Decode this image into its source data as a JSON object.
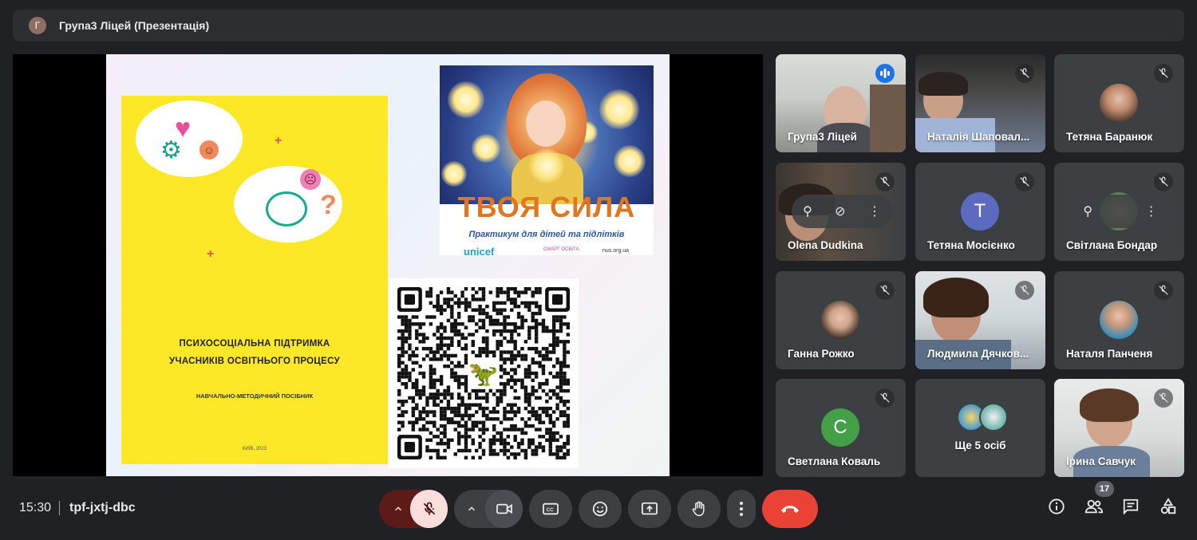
{
  "meeting": {
    "title_initial": "Г",
    "title": "Група3 Ліцей (Презентація)",
    "time": "15:30",
    "code": "tpf-jxtj-dbc",
    "participant_count": "17"
  },
  "slide": {
    "book": {
      "title_line1": "ПСИХОСОЦІАЛЬНА ПІДТРИМКА",
      "title_line2": "УЧАСНИКІВ ОСВІТНЬОГО ПРОЦЕСУ",
      "subtitle": "НАВЧАЛЬНО-МЕТОДИЧНИЙ ПОСІБНИК",
      "city": "КИЇВ, 2023"
    },
    "cover": {
      "title": "ТВОЯ СИЛА",
      "subtitle": "Практикум для дітей та підлітків",
      "logo_unicef": "unicef",
      "logo_smart": "СМАРТ ОСВІТА",
      "logo_nus": "nus.org.ua"
    }
  },
  "participants": [
    {
      "name": "Група3 Ліцей",
      "state": "speaking"
    },
    {
      "name": "Наталія Шаповал...",
      "state": "muted"
    },
    {
      "name": "Тетяна Баранюк",
      "state": "muted"
    },
    {
      "name": "Olena Dudkina",
      "state": "muted"
    },
    {
      "name": "Тетяна Мосієнко",
      "state": "muted",
      "initial": "Т"
    },
    {
      "name": "Світлана Бондар",
      "state": "muted"
    },
    {
      "name": "Ганна Рожко",
      "state": "muted"
    },
    {
      "name": "Людмила Дячков...",
      "state": "muted"
    },
    {
      "name": "Наталя Панченя",
      "state": "muted"
    },
    {
      "name": "Светлана Коваль",
      "state": "muted",
      "initial": "C"
    },
    {
      "name": "Ще 5 осіб",
      "state": "more"
    },
    {
      "name": "Ірина Савчук",
      "state": "muted"
    }
  ],
  "colors": {
    "accent_blue": "#1a73e8",
    "end_call_red": "#ea4335",
    "mic_off_pink": "#f9dedc",
    "avatar_purple": "#5c6bc0",
    "avatar_green": "#43a047"
  },
  "controls": {
    "icons": [
      "chevron-up-icon",
      "mic-off-icon",
      "chevron-up-icon",
      "camera-icon",
      "captions-icon",
      "emoji-icon",
      "present-icon",
      "raise-hand-icon",
      "more-icon",
      "end-call-icon"
    ],
    "right_icons": [
      "info-icon",
      "people-icon",
      "chat-icon",
      "activities-icon"
    ]
  }
}
